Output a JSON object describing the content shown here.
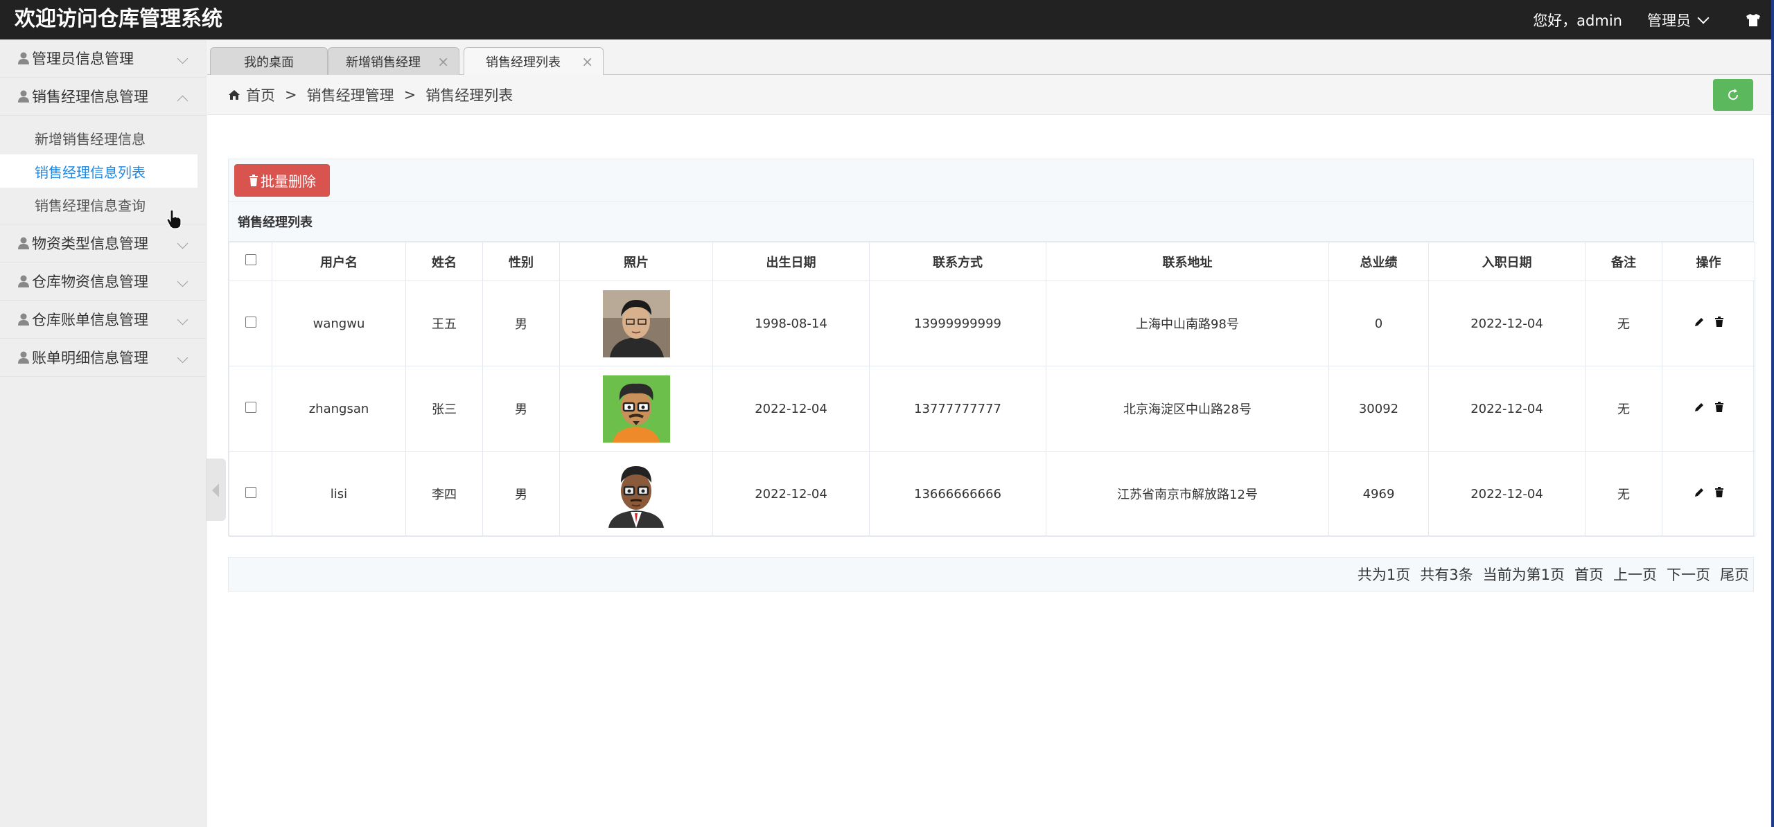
{
  "header": {
    "title": "欢迎访问仓库管理系统",
    "greeting": "您好，admin",
    "user_menu_label": "管理员"
  },
  "sidebar": {
    "items": [
      {
        "label": "管理员信息管理",
        "expanded": false
      },
      {
        "label": "销售经理信息管理",
        "expanded": true,
        "children": [
          {
            "label": "新增销售经理信息",
            "active": false
          },
          {
            "label": "销售经理信息列表",
            "active": true
          },
          {
            "label": "销售经理信息查询",
            "active": false
          }
        ]
      },
      {
        "label": "物资类型信息管理",
        "expanded": false
      },
      {
        "label": "仓库物资信息管理",
        "expanded": false
      },
      {
        "label": "仓库账单信息管理",
        "expanded": false
      },
      {
        "label": "账单明细信息管理",
        "expanded": false
      }
    ]
  },
  "tabs": [
    {
      "label": "我的桌面",
      "closable": false,
      "active": false
    },
    {
      "label": "新增销售经理",
      "closable": true,
      "active": false
    },
    {
      "label": "销售经理列表",
      "closable": true,
      "active": true
    }
  ],
  "tab_close_glyph": "×",
  "breadcrumb": {
    "home": "首页",
    "sep": ">",
    "level1": "销售经理管理",
    "level2": "销售经理列表"
  },
  "toolbar": {
    "batch_delete_label": "批量删除"
  },
  "table": {
    "caption": "销售经理列表",
    "columns": [
      "用户名",
      "姓名",
      "性别",
      "照片",
      "出生日期",
      "联系方式",
      "联系地址",
      "总业绩",
      "入职日期",
      "备注",
      "操作"
    ],
    "rows": [
      {
        "username": "wangwu",
        "name": "王五",
        "gender": "男",
        "photo": "young-man-photo",
        "birth": "1998-08-14",
        "phone": "13999999999",
        "address": "上海中山南路98号",
        "performance": "0",
        "hire_date": "2022-12-04",
        "remark": "无"
      },
      {
        "username": "zhangsan",
        "name": "张三",
        "gender": "男",
        "photo": "cartoon-glasses-avatar",
        "birth": "2022-12-04",
        "phone": "13777777777",
        "address": "北京海淀区中山路28号",
        "performance": "30092",
        "hire_date": "2022-12-04",
        "remark": "无"
      },
      {
        "username": "lisi",
        "name": "李四",
        "gender": "男",
        "photo": "cartoon-suit-avatar",
        "birth": "2022-12-04",
        "phone": "13666666666",
        "address": "江苏省南京市解放路12号",
        "performance": "4969",
        "hire_date": "2022-12-04",
        "remark": "无"
      }
    ]
  },
  "pager": {
    "total_pages": "共为1页",
    "total_records": "共有3条",
    "current": "当前为第1页",
    "first": "首页",
    "prev": "上一页",
    "next": "下一页",
    "last": "尾页"
  },
  "colors": {
    "topbar": "#222222",
    "danger": "#d9534f",
    "success": "#5cb85c",
    "active_link": "#1e88e5"
  }
}
